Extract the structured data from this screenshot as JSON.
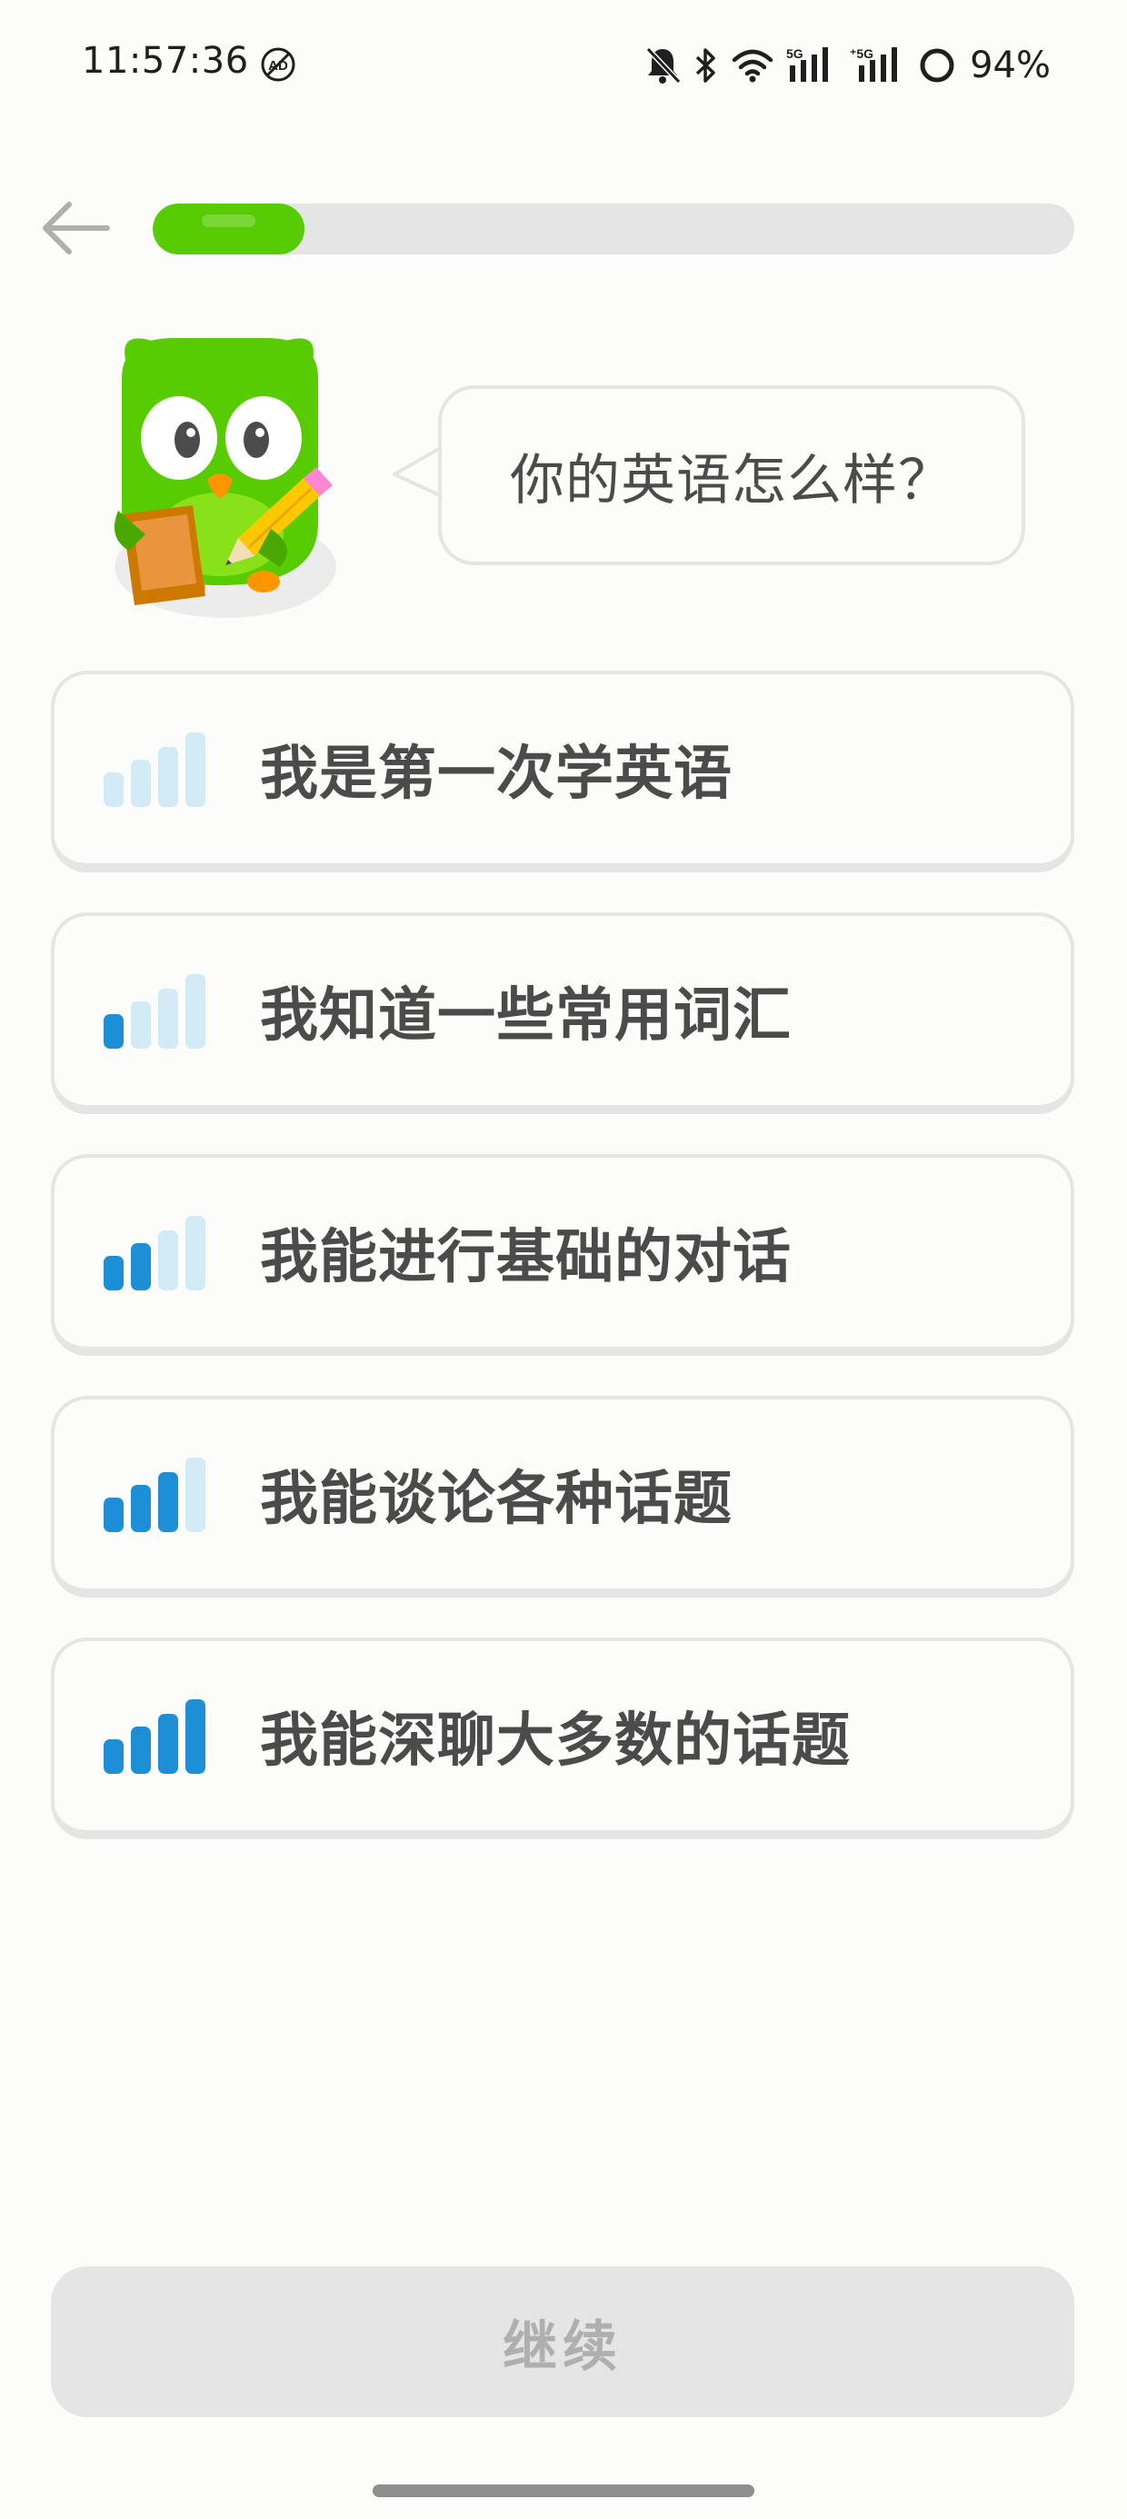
{
  "status_bar": {
    "time": "11:57:36",
    "battery": "94%",
    "icons": [
      "ad-block-icon",
      "mute-bell-icon",
      "bluetooth-icon",
      "wifi-icon",
      "signal-5g-icon",
      "signal-5g-icon",
      "battery-ring-icon"
    ]
  },
  "header": {
    "back_icon": "arrow-left-icon",
    "progress_fraction": 0.165
  },
  "prompt": {
    "mascot": "owl-mascot-with-clipboard",
    "question": "你的英语怎么样？"
  },
  "options": [
    {
      "label": "我是第一次学英语",
      "level": 0,
      "icon": "signal-bars-icon"
    },
    {
      "label": "我知道一些常用词汇",
      "level": 1,
      "icon": "signal-bars-icon"
    },
    {
      "label": "我能进行基础的对话",
      "level": 2,
      "icon": "signal-bars-icon"
    },
    {
      "label": "我能谈论各种话题",
      "level": 3,
      "icon": "signal-bars-icon"
    },
    {
      "label": "我能深聊大多数的话题",
      "level": 4,
      "icon": "signal-bars-icon"
    }
  ],
  "continue": {
    "label": "继续",
    "enabled": false
  },
  "colors": {
    "progress_fill": "#58cc02",
    "bar_active": "#1c8fd6",
    "bar_inactive": "#d3eaf7",
    "border": "#e5e5e5",
    "text": "#4b4b4b",
    "button_disabled_bg": "#e5e5e5",
    "button_disabled_text": "#afafaf"
  }
}
